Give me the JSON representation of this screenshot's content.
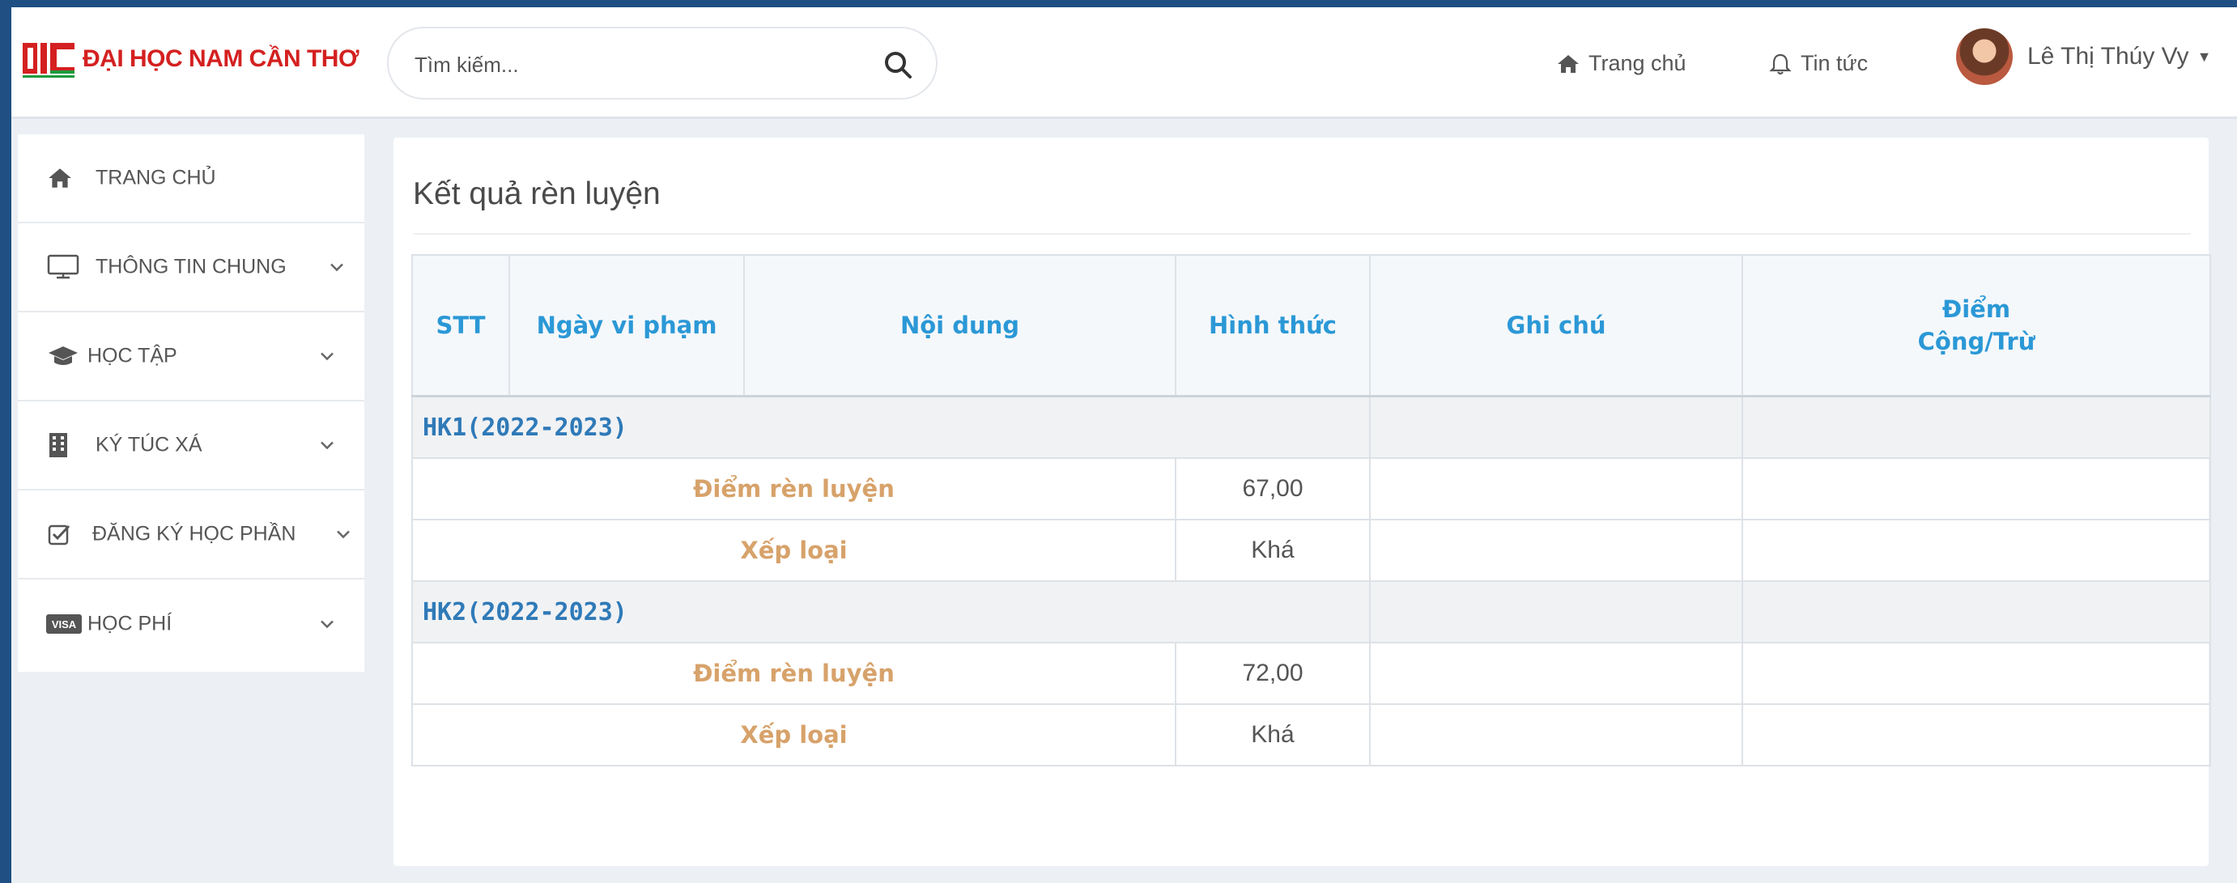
{
  "header": {
    "logo_text": "ĐẠI HỌC NAM CẦN THƠ",
    "search_placeholder": "Tìm kiếm...",
    "nav_home": "Trang chủ",
    "nav_news": "Tin tức",
    "user_name": "Lê Thị Thúy Vy"
  },
  "sidebar": {
    "items": [
      {
        "label": "TRANG CHỦ",
        "icon": "home-icon"
      },
      {
        "label": "THÔNG TIN CHUNG",
        "icon": "monitor-icon"
      },
      {
        "label": "HỌC TẬP",
        "icon": "graduation-cap-icon"
      },
      {
        "label": "KÝ TÚC XÁ",
        "icon": "building-icon"
      },
      {
        "label": "ĐĂNG KÝ HỌC PHẦN",
        "icon": "checkbox-icon"
      },
      {
        "label": "HỌC PHÍ",
        "icon": "visa-card-icon"
      }
    ]
  },
  "main": {
    "title": "Kết quả rèn luyện",
    "columns": {
      "stt": "STT",
      "date": "Ngày vi phạm",
      "content": "Nội dung",
      "form": "Hình thức",
      "note": "Ghi chú",
      "points_line1": "Điểm",
      "points_line2": "Cộng/Trừ"
    },
    "semesters": [
      {
        "label": "HK1(2022-2023)",
        "score_label": "Điểm rèn luyện",
        "score": "67,00",
        "rank_label": "Xếp loại",
        "rank": "Khá"
      },
      {
        "label": "HK2(2022-2023)",
        "score_label": "Điểm rèn luyện",
        "score": "72,00",
        "rank_label": "Xếp loại",
        "rank": "Khá"
      }
    ]
  },
  "colors": {
    "frame": "#1f4f83",
    "accent_blue": "#2b98d6",
    "semester_blue": "#2f7ab8",
    "label_gold": "#d7a26a",
    "logo_red": "#d42020"
  }
}
